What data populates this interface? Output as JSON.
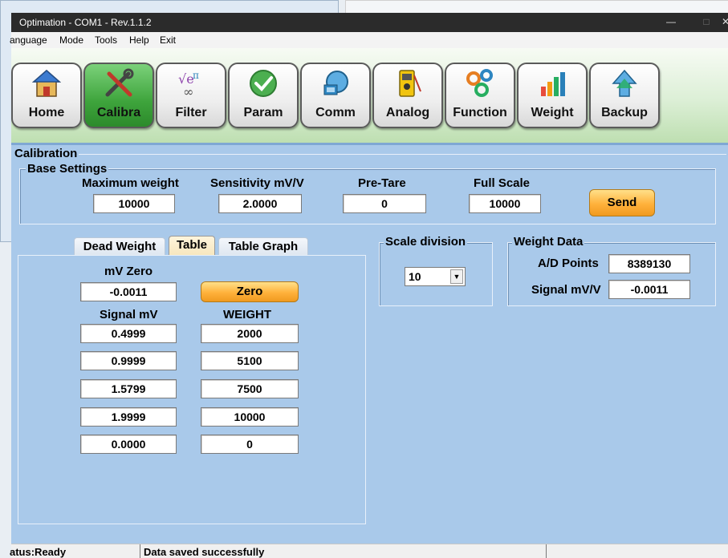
{
  "window": {
    "title": "Optimation - COM1 - Rev.1.1.2",
    "minimize": "—",
    "maximize": "□",
    "close": "✕"
  },
  "menu": [
    "anguage",
    "Mode",
    "Tools",
    "Help",
    "Exit"
  ],
  "toolbar": [
    {
      "label": "Home",
      "icon": "home-icon"
    },
    {
      "label": "Calibra",
      "icon": "tools-icon",
      "active": true
    },
    {
      "label": "Filter",
      "icon": "formula-icon"
    },
    {
      "label": "Param",
      "icon": "checkmark-icon"
    },
    {
      "label": "Comm",
      "icon": "network-icon"
    },
    {
      "label": "Analog",
      "icon": "multimeter-icon"
    },
    {
      "label": "Function",
      "icon": "gears-icon"
    },
    {
      "label": "Weight",
      "icon": "bar-chart-icon"
    },
    {
      "label": "Backup",
      "icon": "upload-arrow-icon"
    }
  ],
  "calibration": {
    "title": "Calibration",
    "base_settings": {
      "title": "Base Settings",
      "max_weight_label": "Maximum weight",
      "max_weight_value": "10000",
      "sensitivity_label": "Sensitivity mV/V",
      "sensitivity_value": "2.0000",
      "pretare_label": "Pre-Tare",
      "pretare_value": "0",
      "fullscale_label": "Full Scale",
      "fullscale_value": "10000",
      "send_label": "Send"
    },
    "tabs": [
      "Dead Weight",
      "Table",
      "Table Graph"
    ],
    "active_tab": "Table",
    "table": {
      "mv_zero_label": "mV Zero",
      "mv_zero_value": "-0.0011",
      "zero_button": "Zero",
      "signal_header": "Signal mV",
      "weight_header": "WEIGHT",
      "rows": [
        {
          "signal": "0.4999",
          "weight": "2000"
        },
        {
          "signal": "0.9999",
          "weight": "5100"
        },
        {
          "signal": "1.5799",
          "weight": "7500"
        },
        {
          "signal": "1.9999",
          "weight": "10000"
        },
        {
          "signal": "0.0000",
          "weight": "0"
        }
      ]
    },
    "scale_division": {
      "title": "Scale division",
      "value": "10"
    },
    "weight_data": {
      "title": "Weight Data",
      "ad_points_label": "A/D Points",
      "ad_points_value": "8389130",
      "signal_label": "Signal mV/V",
      "signal_value": "-0.0011"
    }
  },
  "status": {
    "state": "atus:Ready",
    "message": "Data saved successfully"
  },
  "colors": {
    "panel": "#a9c9ea",
    "orange_button": "#ffb13b",
    "active_tool": "#3ea43c",
    "titlebar": "#2b2b2b"
  }
}
